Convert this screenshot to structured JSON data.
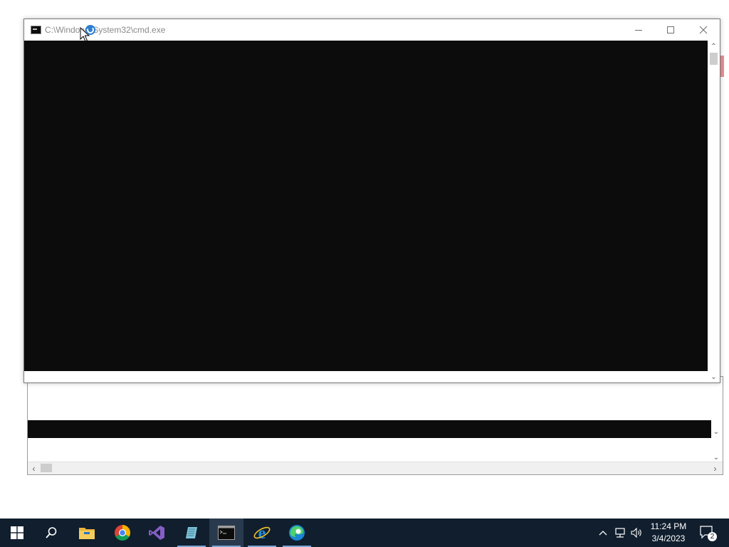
{
  "cmd_window": {
    "title": "C:\\Windows\\System32\\cmd.exe",
    "minimize_icon": "minimize-icon",
    "maximize_icon": "maximize-icon",
    "close_icon": "close-icon"
  },
  "taskbar": {
    "items": [
      {
        "name": "start-button",
        "icon": "windows-logo-icon"
      },
      {
        "name": "search-button",
        "icon": "search-icon"
      },
      {
        "name": "file-explorer",
        "icon": "folder-icon"
      },
      {
        "name": "chrome",
        "icon": "chrome-icon"
      },
      {
        "name": "visual-studio",
        "icon": "visual-studio-icon"
      },
      {
        "name": "scratchpad",
        "icon": "notepad-icon"
      },
      {
        "name": "command-prompt",
        "icon": "cmd-icon"
      },
      {
        "name": "internet-explorer",
        "icon": "ie-icon"
      },
      {
        "name": "edge",
        "icon": "edge-icon"
      }
    ],
    "clock_time": "11:24 PM",
    "clock_date": "3/4/2023",
    "notification_count": "2"
  },
  "colors": {
    "taskbar_bg": "#101e2e",
    "console_bg": "#0c0c0c",
    "accent": "#7aa7d6"
  }
}
